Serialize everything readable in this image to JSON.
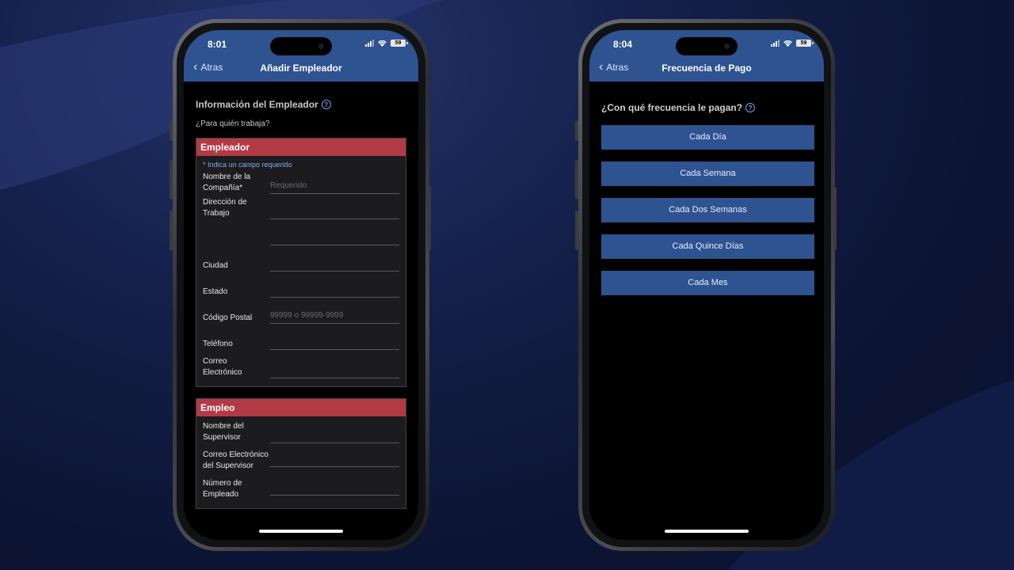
{
  "left_phone": {
    "status": {
      "time": "8:01",
      "battery": "59"
    },
    "nav": {
      "back_label": "Atras",
      "title": "Añadir Empleador"
    },
    "section_title": "Información del Empleador",
    "subquestion": "¿Para quién trabaja?",
    "employer_card": {
      "header": "Empleador",
      "required_note": "* Indica un campo requerido",
      "fields": [
        {
          "label": "Nombre de la Compañía*",
          "placeholder": "Requerido"
        },
        {
          "label": "Dirección de Trabajo",
          "placeholder": ""
        },
        {
          "label": "",
          "placeholder": ""
        },
        {
          "label": "Ciudad",
          "placeholder": ""
        },
        {
          "label": "Estado",
          "placeholder": ""
        },
        {
          "label": "Código Postal",
          "placeholder": "99999 o 99999-9999"
        },
        {
          "label": "Teléfono",
          "placeholder": ""
        },
        {
          "label": "Correo Electrónico",
          "placeholder": ""
        }
      ]
    },
    "employment_card": {
      "header": "Empleo",
      "fields": [
        {
          "label": "Nombre del Supervisor",
          "placeholder": ""
        },
        {
          "label": "Correo Electrónico del Supervisor",
          "placeholder": ""
        },
        {
          "label": "Número de Empleado",
          "placeholder": ""
        }
      ]
    }
  },
  "right_phone": {
    "status": {
      "time": "8:04",
      "battery": "59"
    },
    "nav": {
      "back_label": "Atras",
      "title": "Frecuencia de Pago"
    },
    "question": "¿Con qué frecuencia le pagan?",
    "options": [
      "Cada Día",
      "Cada Semana",
      "Cada Dos Semanas",
      "Cada Quince Días",
      "Cada Mes"
    ]
  },
  "colors": {
    "nav_blue": "#2f5290",
    "card_red": "#b23a44",
    "note_blue": "#7ab4e6"
  },
  "icons": {
    "back": "chevron-left-icon",
    "help": "question-circle-icon",
    "signal": "signal-icon",
    "wifi": "wifi-icon",
    "battery": "battery-icon"
  }
}
